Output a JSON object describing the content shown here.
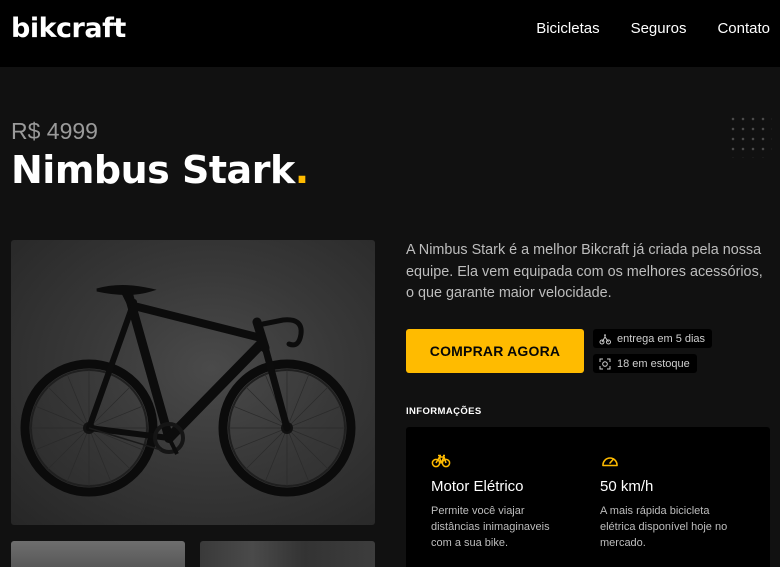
{
  "header": {
    "logo": "bikcraft",
    "nav": [
      "Bicicletas",
      "Seguros",
      "Contato"
    ]
  },
  "product": {
    "price": "R$ 4999",
    "name": "Nimbus Stark",
    "name_dot": ".",
    "description": "A Nimbus Stark é a melhor Bikcraft já criada pela nossa equipe. Ela vem equipada com os melhores acessórios, o que garante maior velocidade.",
    "buy_label": "COMPRAR AGORA",
    "tags": [
      {
        "icon": "delivery-icon",
        "text": "entrega em 5 dias"
      },
      {
        "icon": "stock-icon",
        "text": "18 em estoque"
      }
    ]
  },
  "info": {
    "title": "INFORMAÇÕES",
    "features": [
      {
        "icon": "bike-icon",
        "name": "Motor Elétrico",
        "text": "Permite você viajar distâncias inimaginaveis com a sua bike."
      },
      {
        "icon": "speedometer-icon",
        "name": "50 km/h",
        "text": "A mais rápida bicicleta elétrica disponível hoje no mercado."
      }
    ]
  },
  "colors": {
    "accent": "#ffbb00",
    "background": "#111111",
    "header": "#000000"
  }
}
